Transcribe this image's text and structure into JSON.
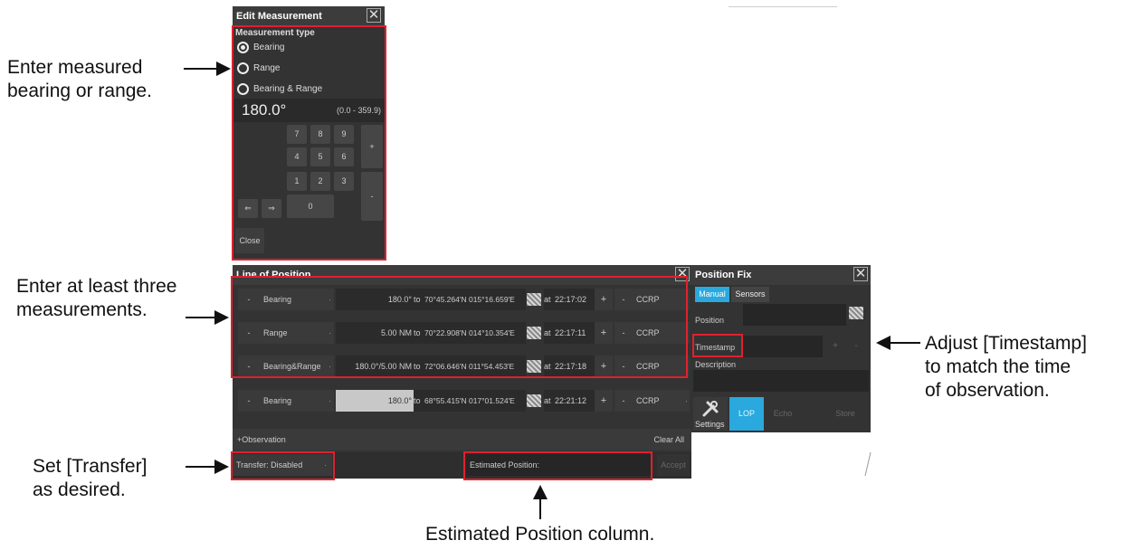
{
  "edit_measurement": {
    "title": "Edit Measurement",
    "close_icon": "close-icon",
    "type_label": "Measurement type",
    "options": [
      "Bearing",
      "Range",
      "Bearing & Range"
    ],
    "selected_option": "Bearing",
    "value": "180.0°",
    "range_hint": "(0.0 - 359.9)",
    "keys": [
      "7",
      "8",
      "9",
      "4",
      "5",
      "6",
      "1",
      "2",
      "3",
      "0"
    ],
    "plus": "+",
    "minus": "-",
    "left_arrow": "⇐",
    "right_arrow": "⇒",
    "close_label": "Close"
  },
  "lop": {
    "title": "Line of Position",
    "rows": [
      {
        "minus": "-",
        "type": "Bearing",
        "value": "180.0°",
        "to": "to",
        "pos": "70°45.264'N 015°16.659'E",
        "at": "at",
        "time": "22:17:02",
        "plus": "+",
        "minus2": "-",
        "ref": "CCRP"
      },
      {
        "minus": "-",
        "type": "Range",
        "value": "5.00 NM",
        "to": "to",
        "pos": "70°22.908'N 014°10.354'E",
        "at": "at",
        "time": "22:17:11",
        "plus": "+",
        "minus2": "-",
        "ref": "CCRP"
      },
      {
        "minus": "-",
        "type": "Bearing&Range",
        "value": "180.0°/5.00 NM",
        "to": "to",
        "pos": "72°06.646'N 011°54.453'E",
        "at": "at",
        "time": "22:17:18",
        "plus": "+",
        "minus2": "-",
        "ref": "CCRP"
      },
      {
        "minus": "-",
        "type": "Bearing",
        "value": "180.0°",
        "to": "to",
        "pos": "68°55.415'N 017°01.524'E",
        "at": "at",
        "time": "22:21:12",
        "plus": "+",
        "minus2": "-",
        "ref": "CCRP"
      }
    ],
    "add_observation": "+Observation",
    "clear_all": "Clear All",
    "transfer": "Transfer: Disabled",
    "estimated_position": "Estimated Position:",
    "accept": "Accept"
  },
  "position_fix": {
    "title": "Position Fix",
    "tabs": [
      "Manual",
      "Sensors"
    ],
    "active_tab": "Manual",
    "position_label": "Position",
    "timestamp_label": "Timestamp",
    "plus": "+",
    "minus": "-",
    "description_label": "Description",
    "settings_label": "Settings",
    "buttons": [
      "LOP",
      "Echo",
      "Store"
    ]
  },
  "callouts": {
    "enter_measured": "Enter measured\nbearing or range.",
    "enter_three": "Enter at least three\nmeasurements.",
    "adjust_timestamp": "Adjust [Timestamp]\nto match the time\nof observation.",
    "set_transfer": "Set [Transfer]\nas desired.",
    "estimated_column": "Estimated Position column."
  },
  "colors": {
    "annotation_red": "#e0202f",
    "panel_bg": "#333333",
    "accent_blue": "#29a9dd"
  }
}
